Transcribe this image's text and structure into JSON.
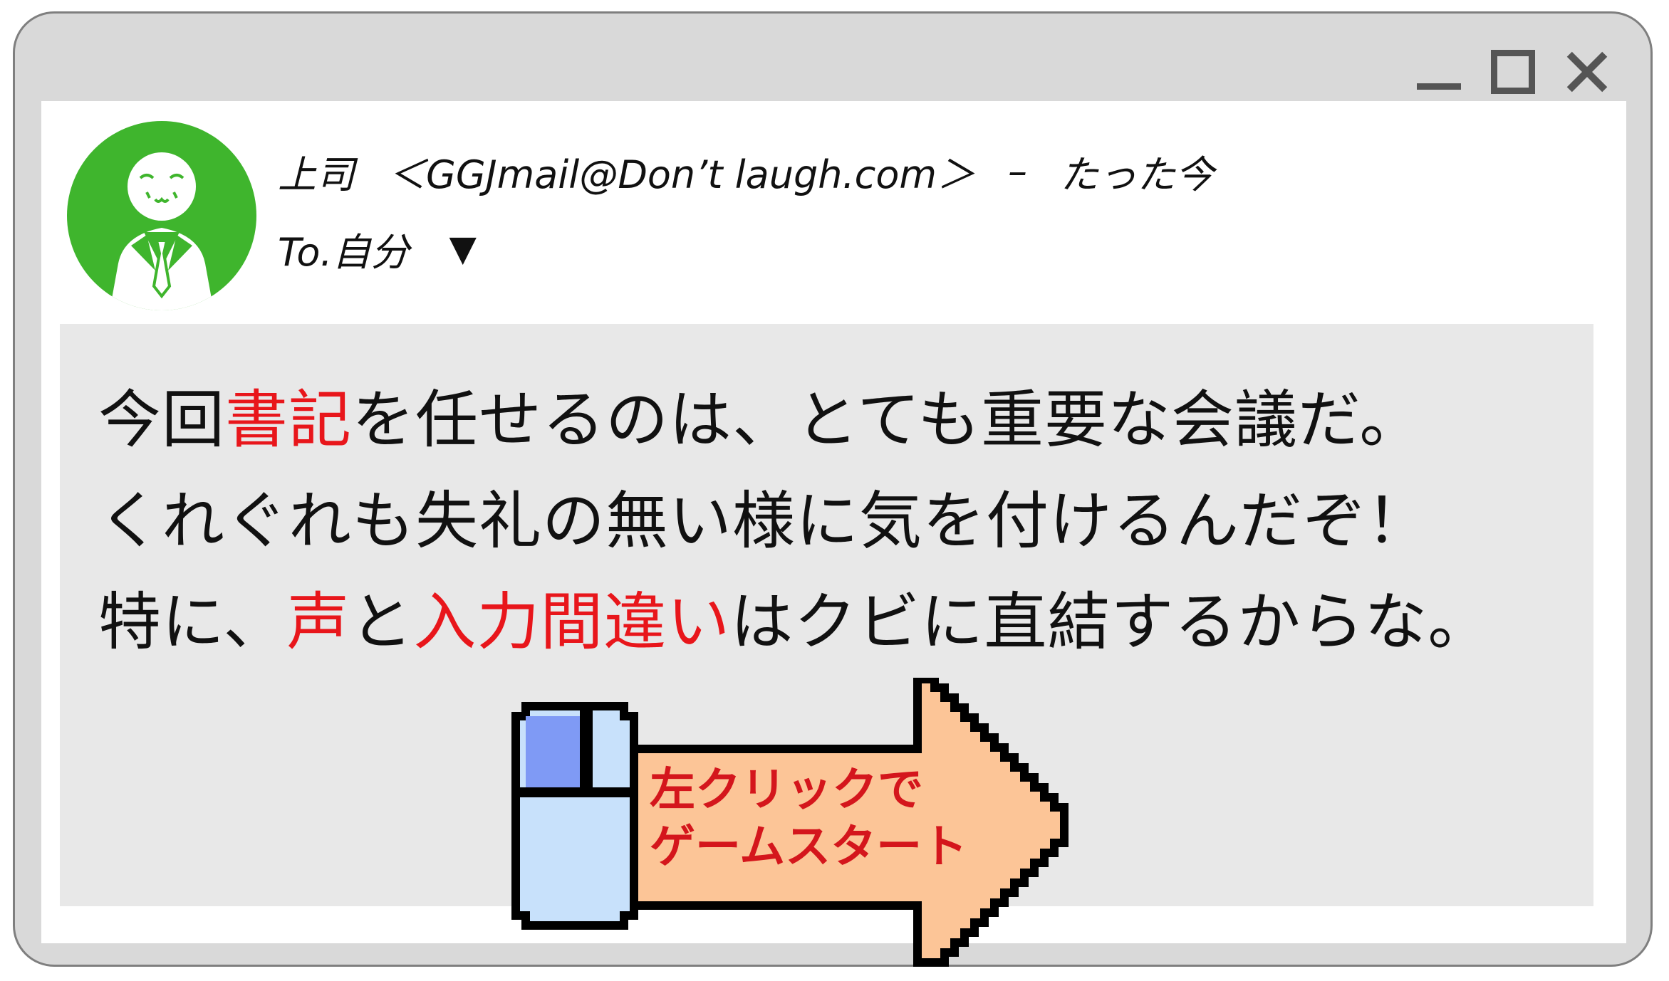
{
  "window": {
    "controls": [
      {
        "name": "minimize-button",
        "icon": "minimize-icon"
      },
      {
        "name": "maximize-button",
        "icon": "maximize-icon"
      },
      {
        "name": "close-button",
        "icon": "close-icon"
      }
    ]
  },
  "email": {
    "avatar_icon": "boss-avatar-icon",
    "sender_name": "上司",
    "sender_address": "＜GGJmail@Don’t laugh.com＞",
    "separator": "–",
    "time": "たった今",
    "to_label": "To.自分",
    "to_dropdown": "▼"
  },
  "message": {
    "line1": [
      {
        "text": "今回",
        "highlight": false
      },
      {
        "text": "書記",
        "highlight": true
      },
      {
        "text": "を任せるのは、とても重要な会議だ。",
        "highlight": false
      }
    ],
    "line2": [
      {
        "text": "くれぐれも失礼の無い様に気を付けるんだぞ！",
        "highlight": false
      }
    ],
    "line3": [
      {
        "text": "特に、",
        "highlight": false
      },
      {
        "text": "声",
        "highlight": true
      },
      {
        "text": "と",
        "highlight": false
      },
      {
        "text": "入力間違い",
        "highlight": true
      },
      {
        "text": "はクビに直結するからな。",
        "highlight": false
      }
    ]
  },
  "start_button": {
    "line1": "左クリックで",
    "line2": "ゲームスタート",
    "icon": "mouse-icon",
    "arrow_icon": "arrow-right-icon"
  },
  "colors": {
    "highlight": "#e8161b",
    "avatar_bg": "#3fb52d",
    "arrow_fill": "#fcc597",
    "mouse_left_button": "#7f9af5",
    "mouse_body": "#c8e1fb"
  }
}
